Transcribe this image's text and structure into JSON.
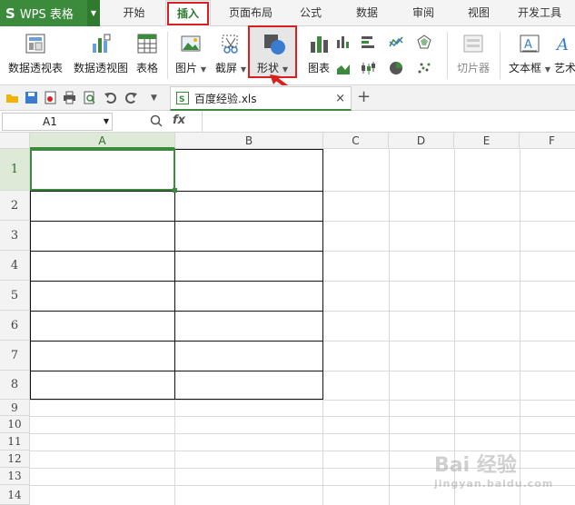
{
  "app": {
    "logo": "S",
    "title": "WPS 表格"
  },
  "tabs": [
    {
      "label": "开始"
    },
    {
      "label": "插入"
    },
    {
      "label": "页面布局"
    },
    {
      "label": "公式"
    },
    {
      "label": "数据"
    },
    {
      "label": "审阅"
    },
    {
      "label": "视图"
    },
    {
      "label": "开发工具"
    }
  ],
  "ribbon": {
    "pivot_table": "数据透视表",
    "pivot_chart": "数据透视图",
    "table": "表格",
    "picture": "图片",
    "screenshot": "截屏",
    "shapes": "形状",
    "chart": "图表",
    "slicer": "切片器",
    "textbox": "文本框",
    "art": "艺术"
  },
  "document": {
    "name": "百度经验.xls",
    "close": "×",
    "new_tab": "+"
  },
  "formula_bar": {
    "cell_ref": "A1",
    "fx": "fx",
    "value": ""
  },
  "columns": [
    "A",
    "B",
    "C",
    "D",
    "E",
    "F"
  ],
  "rows": [
    "1",
    "2",
    "3",
    "4",
    "5",
    "6",
    "7",
    "8",
    "9",
    "10",
    "11",
    "12",
    "13",
    "14"
  ],
  "watermark": {
    "text": "Bai 经验",
    "sub": "jingyan.baidu.com"
  },
  "colors": {
    "accent": "#3c8a3c",
    "highlight": "#d9201f"
  }
}
